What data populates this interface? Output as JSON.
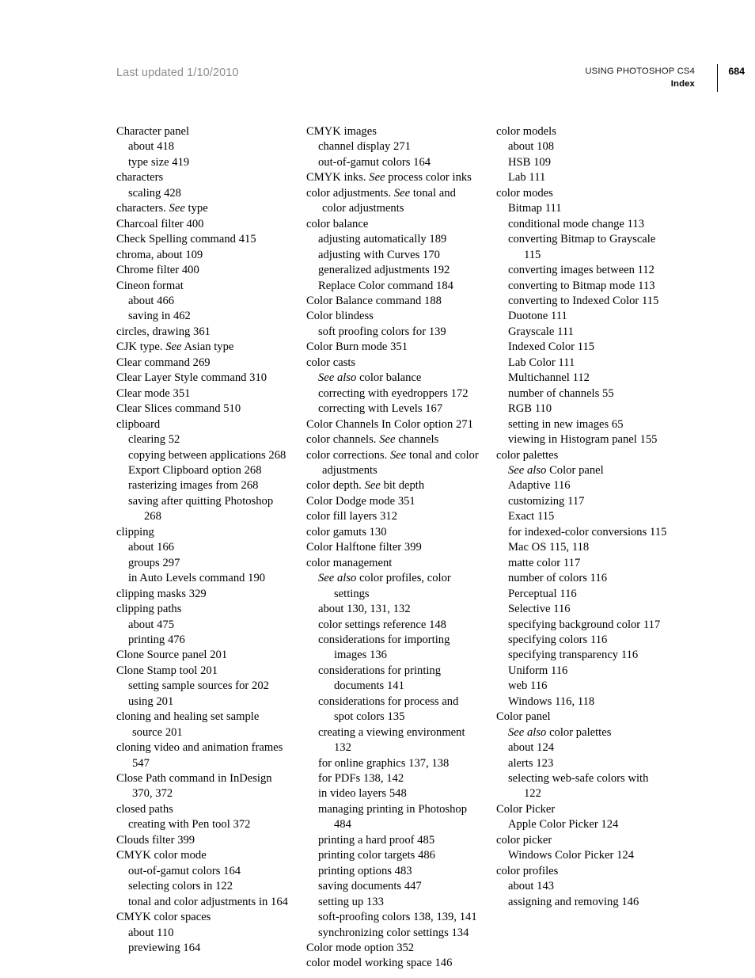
{
  "header": {
    "last_updated": "Last updated 1/10/2010",
    "doc_title": "USING PHOTOSHOP CS4",
    "section": "Index",
    "page_number": "684"
  },
  "columns": [
    {
      "name": "index-column-1",
      "entries": [
        {
          "level": 1,
          "text": "Character panel"
        },
        {
          "level": 2,
          "text": "about 418"
        },
        {
          "level": 2,
          "text": "type size 419"
        },
        {
          "level": 1,
          "text": "characters"
        },
        {
          "level": 2,
          "text": "scaling 428"
        },
        {
          "level": 1,
          "html": "characters. <i>See</i> type"
        },
        {
          "level": 1,
          "text": "Charcoal filter 400"
        },
        {
          "level": 1,
          "text": "Check Spelling command 415"
        },
        {
          "level": 1,
          "text": "chroma, about 109"
        },
        {
          "level": 1,
          "text": "Chrome filter 400"
        },
        {
          "level": 1,
          "text": "Cineon format"
        },
        {
          "level": 2,
          "text": "about 466"
        },
        {
          "level": 2,
          "text": "saving in 462"
        },
        {
          "level": 1,
          "text": "circles, drawing 361"
        },
        {
          "level": 1,
          "html": "CJK type. <i>See</i> Asian type"
        },
        {
          "level": 1,
          "text": "Clear command 269"
        },
        {
          "level": 1,
          "text": "Clear Layer Style command 310"
        },
        {
          "level": 1,
          "text": "Clear mode 351"
        },
        {
          "level": 1,
          "text": "Clear Slices command 510"
        },
        {
          "level": 1,
          "text": "clipboard"
        },
        {
          "level": 2,
          "text": "clearing 52"
        },
        {
          "level": 2,
          "text": "copying between applications 268"
        },
        {
          "level": 2,
          "text": "Export Clipboard option 268"
        },
        {
          "level": 2,
          "text": "rasterizing images from 268"
        },
        {
          "level": 2,
          "text": "saving after quitting Photoshop 268"
        },
        {
          "level": 1,
          "text": "clipping"
        },
        {
          "level": 2,
          "text": "about 166"
        },
        {
          "level": 2,
          "text": "groups 297"
        },
        {
          "level": 2,
          "text": "in Auto Levels command 190"
        },
        {
          "level": 1,
          "text": "clipping masks 329"
        },
        {
          "level": 1,
          "text": "clipping paths"
        },
        {
          "level": 2,
          "text": "about 475"
        },
        {
          "level": 2,
          "text": "printing 476"
        },
        {
          "level": 1,
          "text": "Clone Source panel 201"
        },
        {
          "level": 1,
          "text": "Clone Stamp tool 201"
        },
        {
          "level": 2,
          "text": "setting sample sources for 202"
        },
        {
          "level": 2,
          "text": "using 201"
        },
        {
          "level": 1,
          "text": "cloning and healing set sample source 201"
        },
        {
          "level": 1,
          "text": "cloning video and animation frames 547"
        },
        {
          "level": 1,
          "text": "Close Path command in InDesign 370, 372"
        },
        {
          "level": 1,
          "text": "closed paths"
        },
        {
          "level": 2,
          "text": "creating with Pen tool 372"
        },
        {
          "level": 1,
          "text": "Clouds filter 399"
        },
        {
          "level": 1,
          "text": "CMYK color mode"
        },
        {
          "level": 2,
          "text": "out-of-gamut colors 164"
        },
        {
          "level": 2,
          "text": "selecting colors in 122"
        },
        {
          "level": 2,
          "text": "tonal and color adjustments in 164"
        },
        {
          "level": 1,
          "text": "CMYK color spaces"
        },
        {
          "level": 2,
          "text": "about 110"
        },
        {
          "level": 2,
          "text": "previewing 164"
        }
      ]
    },
    {
      "name": "index-column-2",
      "entries": [
        {
          "level": 1,
          "text": "CMYK images"
        },
        {
          "level": 2,
          "text": "channel display 271"
        },
        {
          "level": 2,
          "text": "out-of-gamut colors 164"
        },
        {
          "level": 1,
          "html": "CMYK inks. <i>See</i> process color inks"
        },
        {
          "level": 1,
          "html": "color adjustments. <i>See</i> tonal and color adjustments"
        },
        {
          "level": 1,
          "text": "color balance"
        },
        {
          "level": 2,
          "text": "adjusting automatically 189"
        },
        {
          "level": 2,
          "text": "adjusting with Curves 170"
        },
        {
          "level": 2,
          "text": "generalized adjustments 192"
        },
        {
          "level": 2,
          "text": "Replace Color command 184"
        },
        {
          "level": 1,
          "text": "Color Balance command 188"
        },
        {
          "level": 1,
          "text": "Color blindess"
        },
        {
          "level": 2,
          "text": "soft proofing colors for 139"
        },
        {
          "level": 1,
          "text": "Color Burn mode 351"
        },
        {
          "level": 1,
          "text": "color casts"
        },
        {
          "level": 2,
          "html": "<i>See also</i> color balance"
        },
        {
          "level": 2,
          "text": "correcting with eyedroppers 172"
        },
        {
          "level": 2,
          "text": "correcting with Levels 167"
        },
        {
          "level": 1,
          "text": "Color Channels In Color option 271"
        },
        {
          "level": 1,
          "html": "color channels. <i>See</i> channels"
        },
        {
          "level": 1,
          "html": "color corrections. <i>See</i> tonal and color adjustments"
        },
        {
          "level": 1,
          "html": "color depth. <i>See</i> bit depth"
        },
        {
          "level": 1,
          "text": "Color Dodge mode 351"
        },
        {
          "level": 1,
          "text": "color fill layers 312"
        },
        {
          "level": 1,
          "text": "color gamuts 130"
        },
        {
          "level": 1,
          "text": "Color Halftone filter 399"
        },
        {
          "level": 1,
          "text": "color management"
        },
        {
          "level": 2,
          "html": "<i>See also</i> color profiles, color settings"
        },
        {
          "level": 2,
          "text": "about 130, 131, 132"
        },
        {
          "level": 2,
          "text": "color settings reference 148"
        },
        {
          "level": 2,
          "text": "considerations for importing images 136"
        },
        {
          "level": 2,
          "text": "considerations for printing documents 141"
        },
        {
          "level": 2,
          "text": "considerations for process and spot colors 135"
        },
        {
          "level": 2,
          "text": "creating a viewing environment 132"
        },
        {
          "level": 2,
          "text": "for online graphics 137, 138"
        },
        {
          "level": 2,
          "text": "for PDFs 138, 142"
        },
        {
          "level": 2,
          "text": "in video layers 548"
        },
        {
          "level": 2,
          "text": "managing printing in Photoshop 484"
        },
        {
          "level": 2,
          "text": "printing a hard proof 485"
        },
        {
          "level": 2,
          "text": "printing color targets 486"
        },
        {
          "level": 2,
          "text": "printing options 483"
        },
        {
          "level": 2,
          "text": "saving documents 447"
        },
        {
          "level": 2,
          "text": "setting up 133"
        },
        {
          "level": 2,
          "text": "soft-proofing colors 138, 139, 141"
        },
        {
          "level": 2,
          "text": "synchronizing color settings 134"
        },
        {
          "level": 1,
          "text": "Color mode option 352"
        },
        {
          "level": 1,
          "text": "color model working space 146"
        }
      ]
    },
    {
      "name": "index-column-3",
      "entries": [
        {
          "level": 1,
          "text": "color models"
        },
        {
          "level": 2,
          "text": "about 108"
        },
        {
          "level": 2,
          "text": "HSB 109"
        },
        {
          "level": 2,
          "text": "Lab 111"
        },
        {
          "level": 1,
          "text": "color modes"
        },
        {
          "level": 2,
          "text": "Bitmap 111"
        },
        {
          "level": 2,
          "text": "conditional mode change 113"
        },
        {
          "level": 2,
          "text": "converting Bitmap to Grayscale 115"
        },
        {
          "level": 2,
          "text": "converting images between 112"
        },
        {
          "level": 2,
          "text": "converting to Bitmap mode 113"
        },
        {
          "level": 2,
          "text": "converting to Indexed Color 115"
        },
        {
          "level": 2,
          "text": "Duotone 111"
        },
        {
          "level": 2,
          "text": "Grayscale 111"
        },
        {
          "level": 2,
          "text": "Indexed Color 115"
        },
        {
          "level": 2,
          "text": "Lab Color 111"
        },
        {
          "level": 2,
          "text": "Multichannel 112"
        },
        {
          "level": 2,
          "text": "number of channels 55"
        },
        {
          "level": 2,
          "text": "RGB 110"
        },
        {
          "level": 2,
          "text": "setting in new images 65"
        },
        {
          "level": 2,
          "text": "viewing in Histogram panel 155"
        },
        {
          "level": 1,
          "text": "color palettes"
        },
        {
          "level": 2,
          "html": "<i>See also</i> Color panel"
        },
        {
          "level": 2,
          "text": "Adaptive 116"
        },
        {
          "level": 2,
          "text": "customizing 117"
        },
        {
          "level": 2,
          "text": "Exact 115"
        },
        {
          "level": 2,
          "text": "for indexed-color conversions 115"
        },
        {
          "level": 2,
          "text": "Mac OS 115, 118"
        },
        {
          "level": 2,
          "text": "matte color 117"
        },
        {
          "level": 2,
          "text": "number of colors 116"
        },
        {
          "level": 2,
          "text": "Perceptual 116"
        },
        {
          "level": 2,
          "text": "Selective 116"
        },
        {
          "level": 2,
          "text": "specifying background color 117"
        },
        {
          "level": 2,
          "text": "specifying colors 116"
        },
        {
          "level": 2,
          "text": "specifying transparency 116"
        },
        {
          "level": 2,
          "text": "Uniform 116"
        },
        {
          "level": 2,
          "text": "web 116"
        },
        {
          "level": 2,
          "text": "Windows 116, 118"
        },
        {
          "level": 1,
          "text": "Color panel"
        },
        {
          "level": 2,
          "html": "<i>See also</i> color palettes"
        },
        {
          "level": 2,
          "text": "about 124"
        },
        {
          "level": 2,
          "text": "alerts 123"
        },
        {
          "level": 2,
          "text": "selecting web-safe colors with 122"
        },
        {
          "level": 1,
          "text": "Color Picker"
        },
        {
          "level": 2,
          "text": "Apple Color Picker 124"
        },
        {
          "level": 1,
          "text": "color picker"
        },
        {
          "level": 2,
          "text": "Windows Color Picker 124"
        },
        {
          "level": 1,
          "text": "color profiles"
        },
        {
          "level": 2,
          "text": "about 143"
        },
        {
          "level": 2,
          "text": "assigning and removing 146"
        }
      ]
    }
  ]
}
